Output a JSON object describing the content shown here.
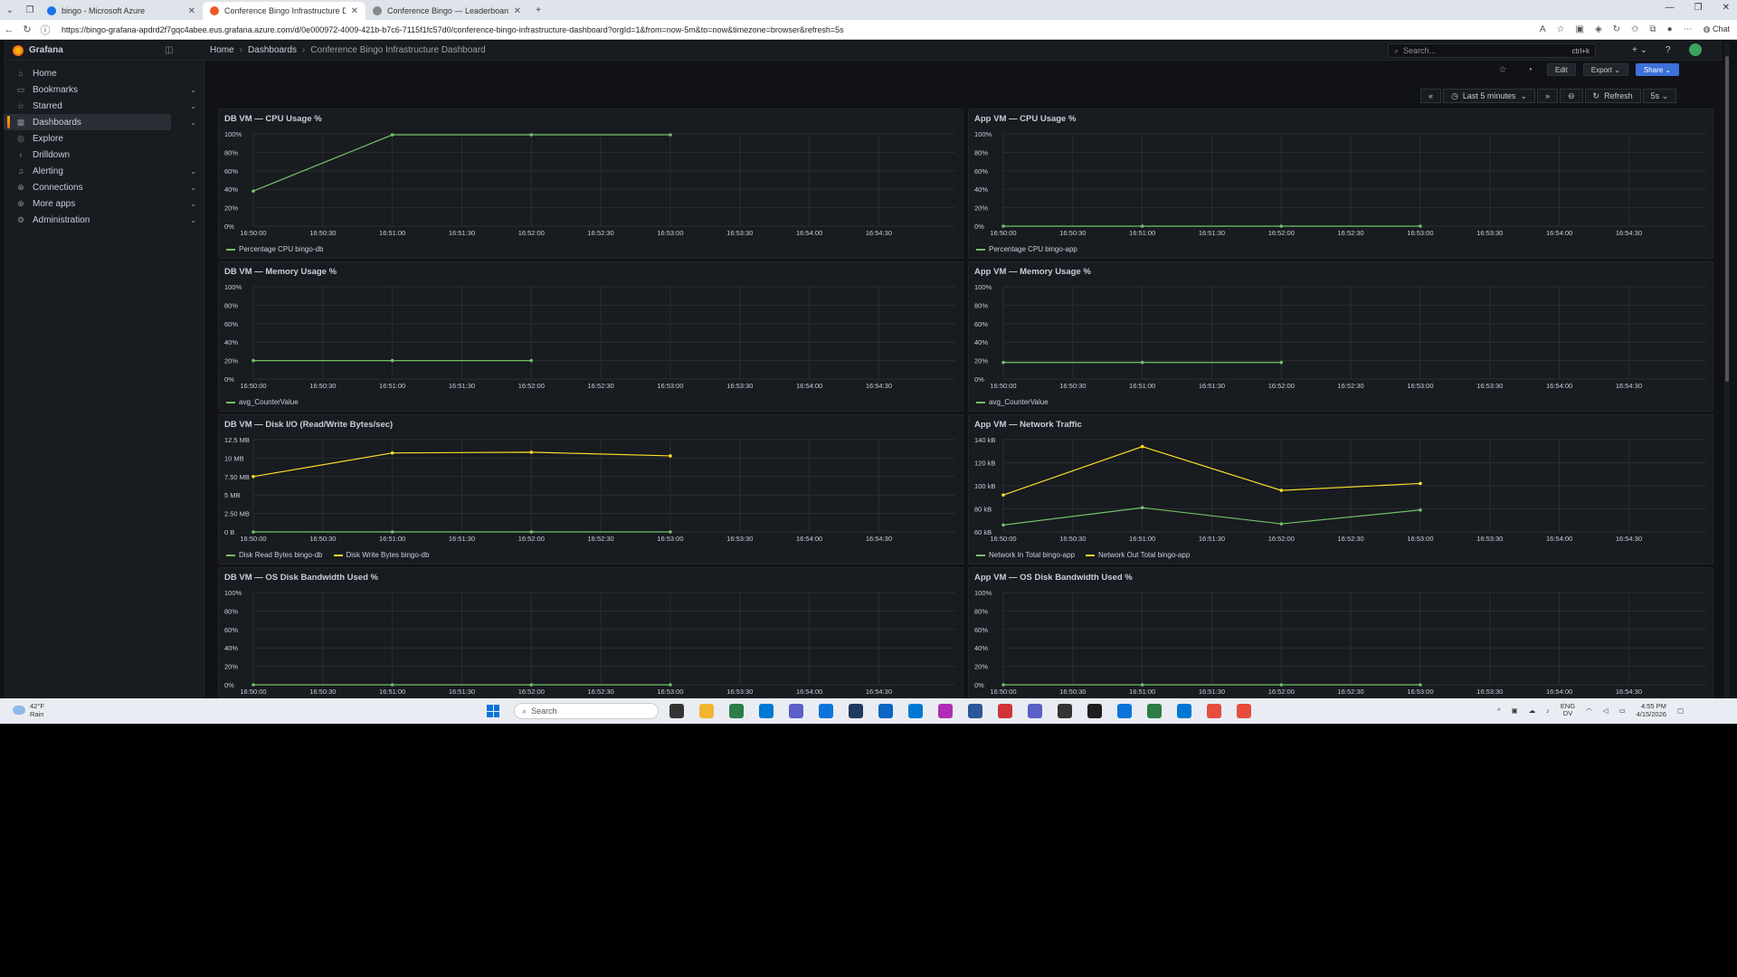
{
  "browser": {
    "tabs": [
      {
        "title": "bingo - Microsoft Azure",
        "fav": "#1a73e8"
      },
      {
        "title": "Conference Bingo Infrastructure D",
        "fav": "#f05a28"
      },
      {
        "title": "Conference Bingo — Leaderboard",
        "fav": "#777"
      }
    ],
    "url": "https://bingo-grafana-apdrd2f7gqc4abee.eus.grafana.azure.com/d/0e000972-4009-421b-b7c6-7115f1fc57d0/conference-bingo-infrastructure-dashboard?orgId=1&from=now-5m&to=now&timezone=browser&refresh=5s",
    "copilot_label": "Chat"
  },
  "grafana": {
    "app_name": "Grafana",
    "breadcrumbs": [
      "Home",
      "Dashboards",
      "Conference Bingo Infrastructure Dashboard"
    ],
    "search_placeholder": "Search...",
    "search_shortcut": "ctrl+k",
    "nav": [
      {
        "label": "Home",
        "icon": "home-icon",
        "glyph": "⌂",
        "chevron": false,
        "active": false
      },
      {
        "label": "Bookmarks",
        "icon": "bookmark-icon",
        "glyph": "▭",
        "chevron": true,
        "active": false
      },
      {
        "label": "Starred",
        "icon": "star-icon",
        "glyph": "☆",
        "chevron": true,
        "active": false
      },
      {
        "label": "Dashboards",
        "icon": "dashboards-icon",
        "glyph": "▦",
        "chevron": true,
        "active": true
      },
      {
        "label": "Explore",
        "icon": "compass-icon",
        "glyph": "◎",
        "chevron": false,
        "active": false
      },
      {
        "label": "Drilldown",
        "icon": "drilldown-icon",
        "glyph": "♁",
        "chevron": false,
        "active": false
      },
      {
        "label": "Alerting",
        "icon": "bell-icon",
        "glyph": "♫",
        "chevron": true,
        "active": false
      },
      {
        "label": "Connections",
        "icon": "connections-icon",
        "glyph": "⊗",
        "chevron": true,
        "active": false
      },
      {
        "label": "More apps",
        "icon": "apps-icon",
        "glyph": "⊕",
        "chevron": true,
        "active": false
      },
      {
        "label": "Administration",
        "icon": "gear-icon",
        "glyph": "⚙",
        "chevron": true,
        "active": false
      }
    ],
    "toolbar": {
      "edit": "Edit",
      "export": "Export",
      "share": "Share"
    },
    "timepicker": {
      "range": "Last 5 minutes",
      "refresh": "Refresh",
      "interval": "5s"
    }
  },
  "panels": [
    {
      "title": "DB VM — CPU Usage %",
      "chart_data": {
        "type": "line",
        "x_ticks": [
          "16:50:00",
          "16:50:30",
          "16:51:00",
          "16:51:30",
          "16:52:00",
          "16:52:30",
          "16:53:00",
          "16:53:30",
          "16:54:00",
          "16:54:30"
        ],
        "y_ticks": [
          "0%",
          "20%",
          "40%",
          "60%",
          "80%",
          "100%"
        ],
        "ylim": [
          0,
          100
        ],
        "xlim": [
          0,
          300
        ],
        "series": [
          {
            "name": "Percentage CPU bingo-db",
            "color": "#73bf69",
            "x": [
              0,
              60,
              120,
              180
            ],
            "y": [
              38,
              99,
              99,
              99
            ]
          }
        ]
      }
    },
    {
      "title": "App VM — CPU Usage %",
      "chart_data": {
        "type": "line",
        "x_ticks": [
          "16:50:00",
          "16:50:30",
          "16:51:00",
          "16:51:30",
          "16:52:00",
          "16:52:30",
          "16:53:00",
          "16:53:30",
          "16:54:00",
          "16:54:30"
        ],
        "y_ticks": [
          "0%",
          "20%",
          "40%",
          "60%",
          "80%",
          "100%"
        ],
        "ylim": [
          0,
          100
        ],
        "xlim": [
          0,
          300
        ],
        "series": [
          {
            "name": "Percentage CPU bingo-app",
            "color": "#73bf69",
            "x": [
              0,
              60,
              120,
              180
            ],
            "y": [
              0,
              0,
              0,
              0
            ]
          }
        ]
      }
    },
    {
      "title": "DB VM — Memory Usage %",
      "chart_data": {
        "type": "line",
        "x_ticks": [
          "16:50:00",
          "16:50:30",
          "16:51:00",
          "16:51:30",
          "16:52:00",
          "16:52:30",
          "16:53:00",
          "16:53:30",
          "16:54:00",
          "16:54:30"
        ],
        "y_ticks": [
          "0%",
          "20%",
          "40%",
          "60%",
          "80%",
          "100%"
        ],
        "ylim": [
          0,
          100
        ],
        "xlim": [
          0,
          300
        ],
        "series": [
          {
            "name": "avg_CounterValue",
            "color": "#73bf69",
            "x": [
              0,
              60,
              120
            ],
            "y": [
              20,
              20,
              20
            ]
          }
        ]
      }
    },
    {
      "title": "App VM — Memory Usage %",
      "chart_data": {
        "type": "line",
        "x_ticks": [
          "16:50:00",
          "16:50:30",
          "16:51:00",
          "16:51:30",
          "16:52:00",
          "16:52:30",
          "16:53:00",
          "16:53:30",
          "16:54:00",
          "16:54:30"
        ],
        "y_ticks": [
          "0%",
          "20%",
          "40%",
          "60%",
          "80%",
          "100%"
        ],
        "ylim": [
          0,
          100
        ],
        "xlim": [
          0,
          300
        ],
        "series": [
          {
            "name": "avg_CounterValue",
            "color": "#73bf69",
            "x": [
              0,
              60,
              120
            ],
            "y": [
              18,
              18,
              18
            ]
          }
        ]
      }
    },
    {
      "title": "DB VM — Disk I/O (Read/Write Bytes/sec)",
      "chart_data": {
        "type": "line",
        "x_ticks": [
          "16:50:00",
          "16:50:30",
          "16:51:00",
          "16:51:30",
          "16:52:00",
          "16:52:30",
          "16:53:00",
          "16:53:30",
          "16:54:00",
          "16:54:30"
        ],
        "y_ticks": [
          "0 B",
          "2.50 MB",
          "5 MB",
          "7.50 MB",
          "10 MB",
          "12.5 MB"
        ],
        "ylim": [
          0,
          12.5
        ],
        "xlim": [
          0,
          300
        ],
        "series": [
          {
            "name": "Disk Read Bytes bingo-db",
            "color": "#73bf69",
            "x": [
              0,
              60,
              120,
              180
            ],
            "y": [
              0,
              0,
              0,
              0
            ]
          },
          {
            "name": "Disk Write Bytes bingo-db",
            "color": "#fade2a",
            "x": [
              0,
              60,
              120,
              180
            ],
            "y": [
              7.5,
              10.7,
              10.8,
              10.3
            ]
          }
        ]
      }
    },
    {
      "title": "App VM — Network Traffic",
      "chart_data": {
        "type": "line",
        "x_ticks": [
          "16:50:00",
          "16:50:30",
          "16:51:00",
          "16:51:30",
          "16:52:00",
          "16:52:30",
          "16:53:00",
          "16:53:30",
          "16:54:00",
          "16:54:30"
        ],
        "y_ticks": [
          "60 kB",
          "80 kB",
          "100 kB",
          "120 kB",
          "140 kB"
        ],
        "ylim": [
          60,
          140
        ],
        "xlim": [
          0,
          300
        ],
        "series": [
          {
            "name": "Network In Total bingo-app",
            "color": "#73bf69",
            "x": [
              0,
              60,
              120,
              180
            ],
            "y": [
              66,
              81,
              67,
              79
            ]
          },
          {
            "name": "Network Out Total bingo-app",
            "color": "#fade2a",
            "x": [
              0,
              60,
              120,
              180
            ],
            "y": [
              92,
              134,
              96,
              102
            ]
          }
        ]
      }
    },
    {
      "title": "DB VM — OS Disk Bandwidth Used %",
      "chart_data": {
        "type": "line",
        "x_ticks": [
          "16:50:00",
          "16:50:30",
          "16:51:00",
          "16:51:30",
          "16:52:00",
          "16:52:30",
          "16:53:00",
          "16:53:30",
          "16:54:00",
          "16:54:30"
        ],
        "y_ticks": [
          "0%",
          "20%",
          "40%",
          "60%",
          "80%",
          "100%"
        ],
        "ylim": [
          0,
          100
        ],
        "xlim": [
          0,
          300
        ],
        "series": [
          {
            "name": "",
            "color": "#73bf69",
            "x": [
              0,
              60,
              120,
              180
            ],
            "y": [
              0,
              0,
              0,
              0
            ]
          }
        ]
      }
    },
    {
      "title": "App VM — OS Disk Bandwidth Used %",
      "chart_data": {
        "type": "line",
        "x_ticks": [
          "16:50:00",
          "16:50:30",
          "16:51:00",
          "16:51:30",
          "16:52:00",
          "16:52:30",
          "16:53:00",
          "16:53:30",
          "16:54:00",
          "16:54:30"
        ],
        "y_ticks": [
          "0%",
          "20%",
          "40%",
          "60%",
          "80%",
          "100%"
        ],
        "ylim": [
          0,
          100
        ],
        "xlim": [
          0,
          300
        ],
        "series": [
          {
            "name": "",
            "color": "#73bf69",
            "x": [
              0,
              60,
              120,
              180
            ],
            "y": [
              0,
              0,
              0,
              0
            ]
          }
        ]
      }
    }
  ],
  "taskbar": {
    "weather_temp": "42°F",
    "weather_desc": "Rain",
    "search_placeholder": "Search",
    "lang_top": "ENG",
    "lang_bottom": "DV",
    "time": "4:55 PM",
    "date": "4/15/2026",
    "app_colors": [
      "#333",
      "#f2b632",
      "#2d7d46",
      "#0078d4",
      "#5b5fc7",
      "#0a74da",
      "#1f3a5f",
      "#0a66c2",
      "#0078d4",
      "#b02cb5",
      "#2b579a",
      "#d13438",
      "#5b5fc7",
      "#333",
      "#1e1e1e",
      "#0a74da",
      "#2d7d46",
      "#0078d4",
      "#e74c3c",
      "#e74c3c"
    ]
  }
}
